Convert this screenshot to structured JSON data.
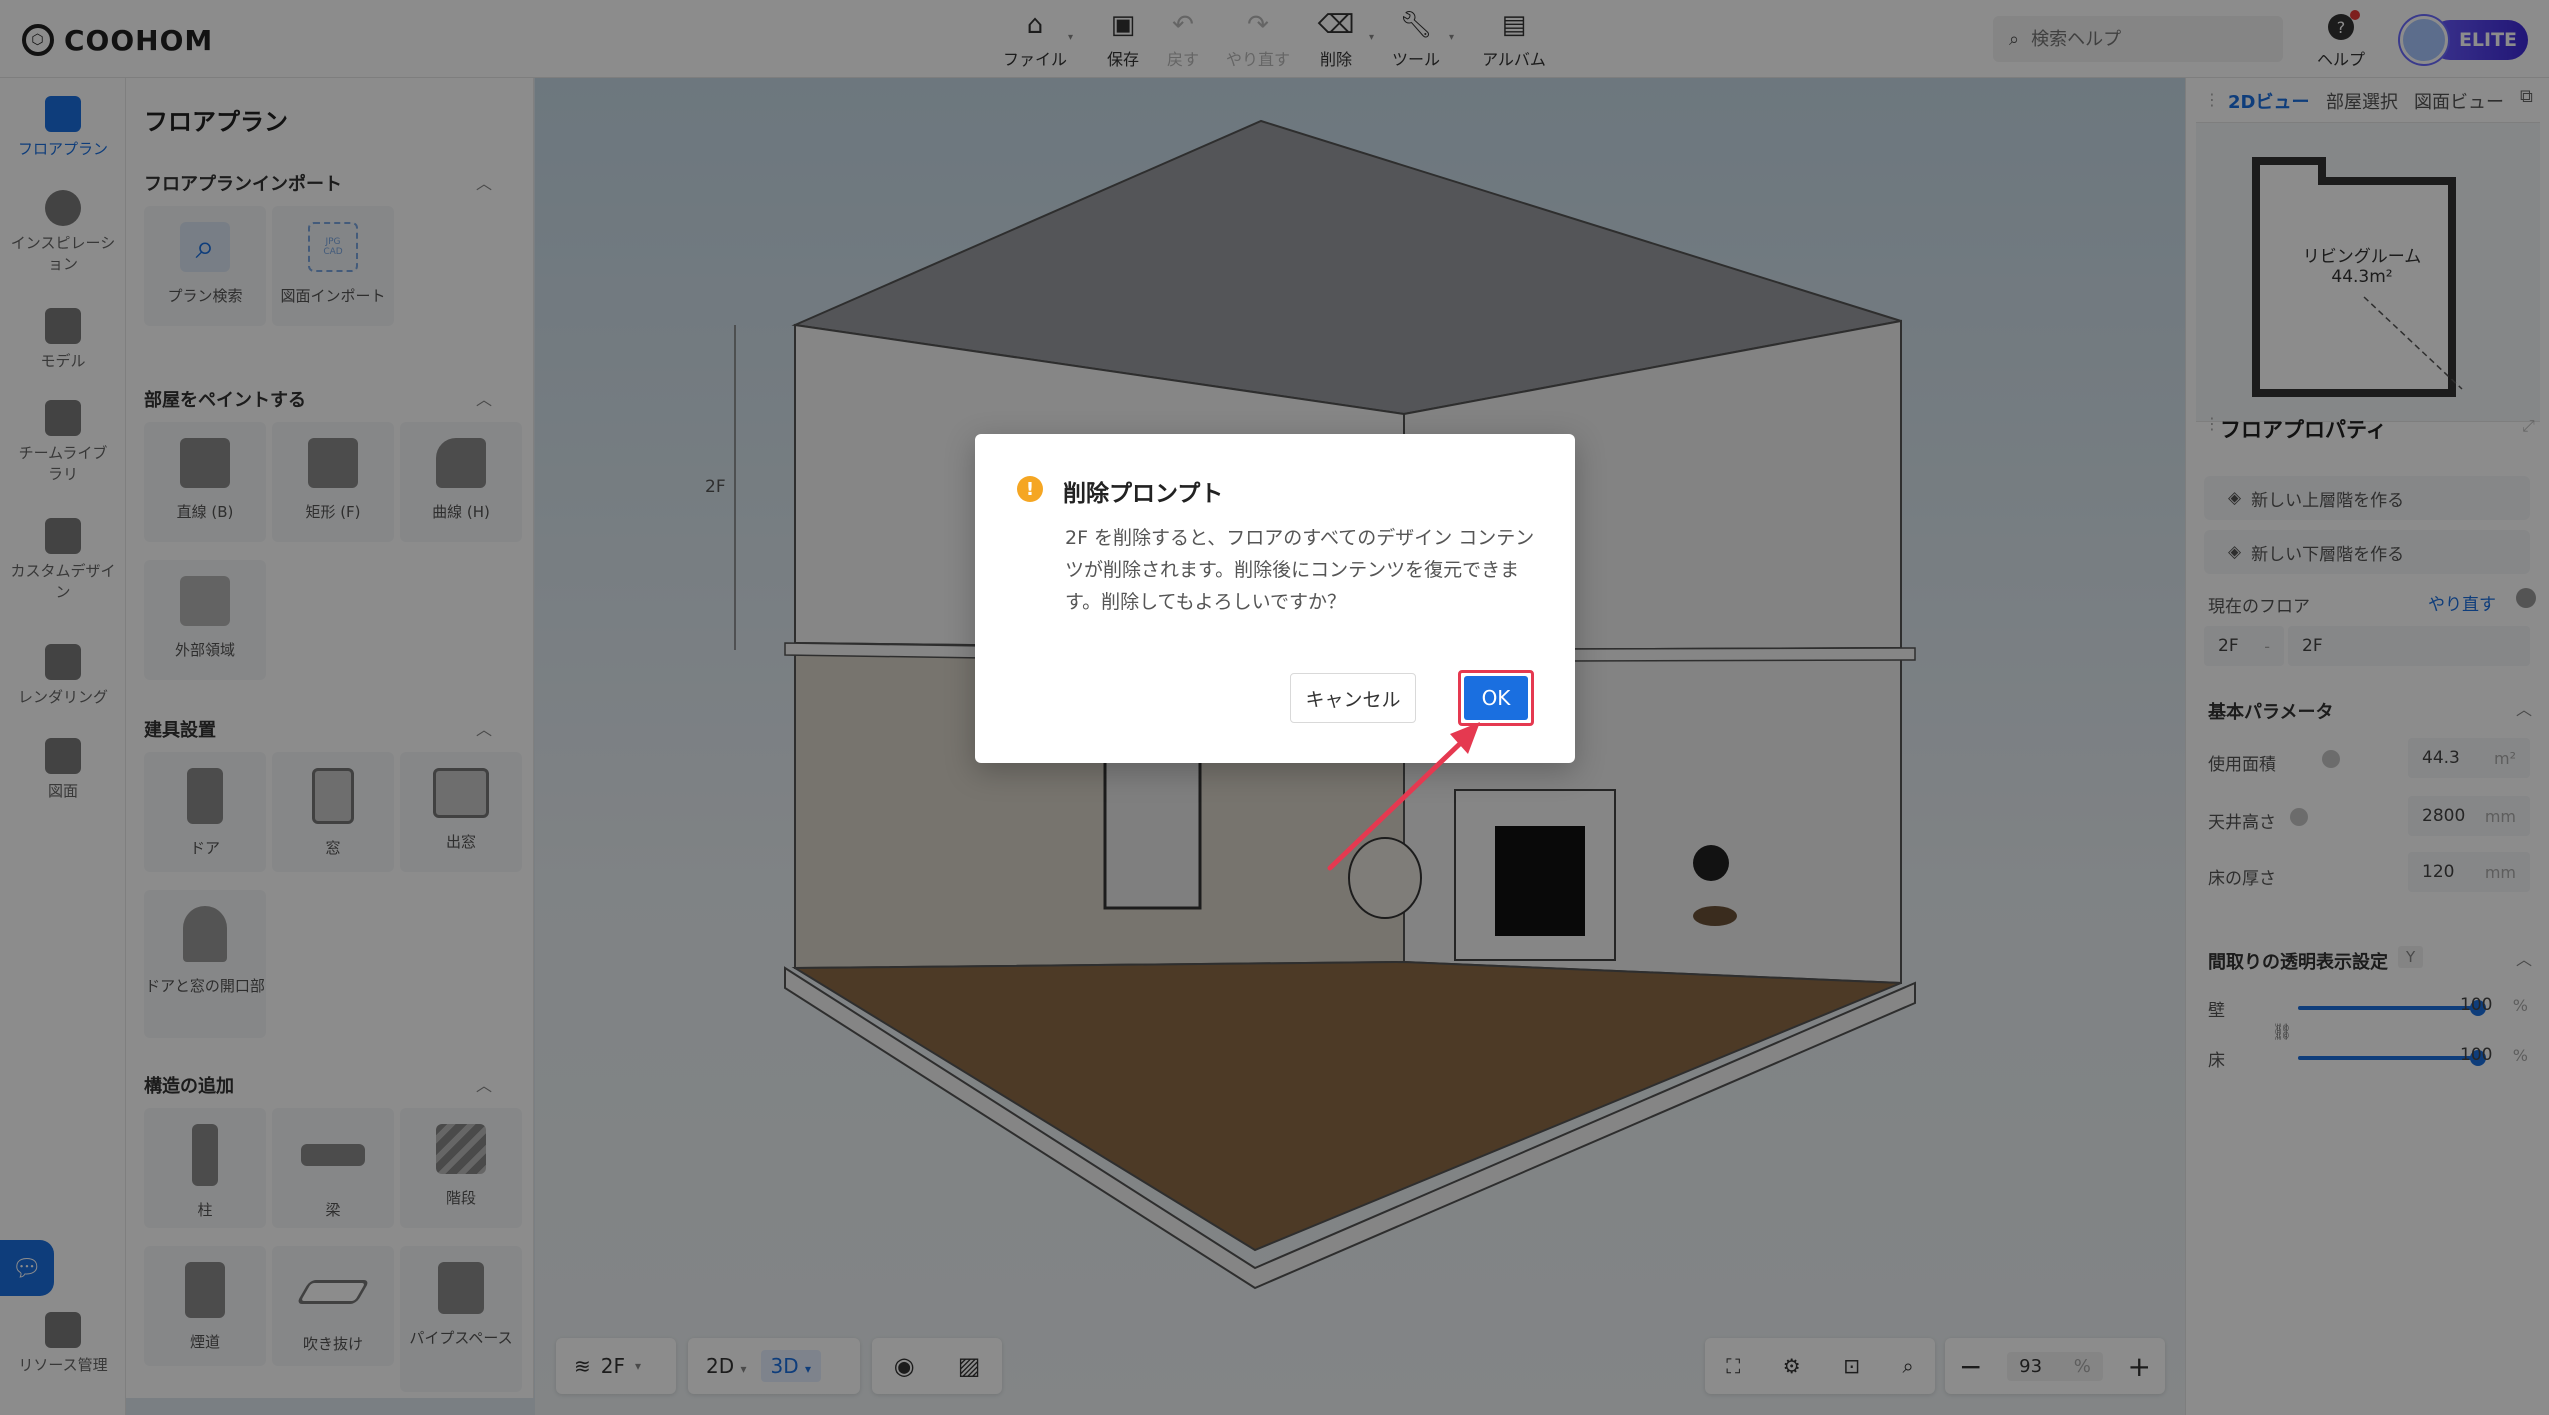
{
  "app": {
    "logo_text": "COOHOM"
  },
  "toolbar": {
    "file": "ファイル",
    "save": "保存",
    "undo": "戻す",
    "redo": "やり直す",
    "delete": "削除",
    "tools": "ツール",
    "album": "アルバム",
    "search_placeholder": "検索ヘルプ",
    "help": "ヘルプ",
    "badge": "ELITE"
  },
  "leftnav": [
    {
      "label": "フロアプラン",
      "active": true
    },
    {
      "label": "インスピレーション"
    },
    {
      "label": "モデル"
    },
    {
      "label": "チームライブラリ"
    },
    {
      "label": "カスタムデザイン"
    },
    {
      "label": "レンダリング"
    },
    {
      "label": "図面"
    },
    {
      "label": "リソース管理"
    }
  ],
  "leftpanel": {
    "title": "フロアプラン",
    "sections": {
      "import": {
        "title": "フロアプランインポート",
        "items": [
          "プラン検索",
          "図面インポート"
        ],
        "tags": [
          "JPG",
          "CAD"
        ]
      },
      "paint": {
        "title": "部屋をペイントする",
        "items": [
          "直線 (B)",
          "矩形 (F)",
          "曲線 (H)",
          "外部領域"
        ]
      },
      "fixtures": {
        "title": "建具設置",
        "items": [
          "ドア",
          "窓",
          "出窓",
          "ドアと窓の開口部"
        ]
      },
      "structure": {
        "title": "構造の追加",
        "items": [
          "柱",
          "梁",
          "階段",
          "煙道",
          "吹き抜け",
          "パイプスペース"
        ]
      }
    }
  },
  "canvas": {
    "floor_label": "2F"
  },
  "bottombar": {
    "floor": "2F",
    "view2d": "2D",
    "view3d": "3D",
    "zoom": "93",
    "zoom_unit": "%"
  },
  "rightpanel": {
    "tabs": [
      "2Dビュー",
      "部屋選択",
      "図面ビュー"
    ],
    "room_name": "リビングルーム",
    "room_area": "44.3m²",
    "floor_props_title": "フロアプロパティ",
    "new_upper": "新しい上層階を作る",
    "new_lower": "新しい下層階を作る",
    "current_floor_label": "現在のフロア",
    "redo_link": "やり直す",
    "floor_code": "2F",
    "floor_sep": "-",
    "floor_name": "2F",
    "basic_params_title": "基本パラメータ",
    "area_label": "使用面積",
    "area_value": "44.3",
    "area_unit": "m²",
    "ceiling_label": "天井高さ",
    "ceiling_value": "2800",
    "ceiling_unit": "mm",
    "floor_thick_label": "床の厚さ",
    "floor_thick_value": "120",
    "floor_thick_unit": "mm",
    "transparency_title": "間取りの透明表示設定",
    "transparency_key": "Y",
    "wall_label": "壁",
    "wall_value": "100",
    "wall_fraction": 1.0,
    "floor_label": "床",
    "floor_value": "100",
    "floor_fraction": 1.0,
    "percent": "%"
  },
  "dialog": {
    "title": "削除プロンプト",
    "message": "2F を削除すると、フロアのすべてのデザイン コンテンツが削除されます。削除後にコンテンツを復元できます。削除してもよろしいですか？",
    "cancel": "キャンセル",
    "ok": "OK"
  },
  "colors": {
    "accent": "#1a6fe0",
    "warning": "#f5a623",
    "highlight": "#e53950"
  }
}
